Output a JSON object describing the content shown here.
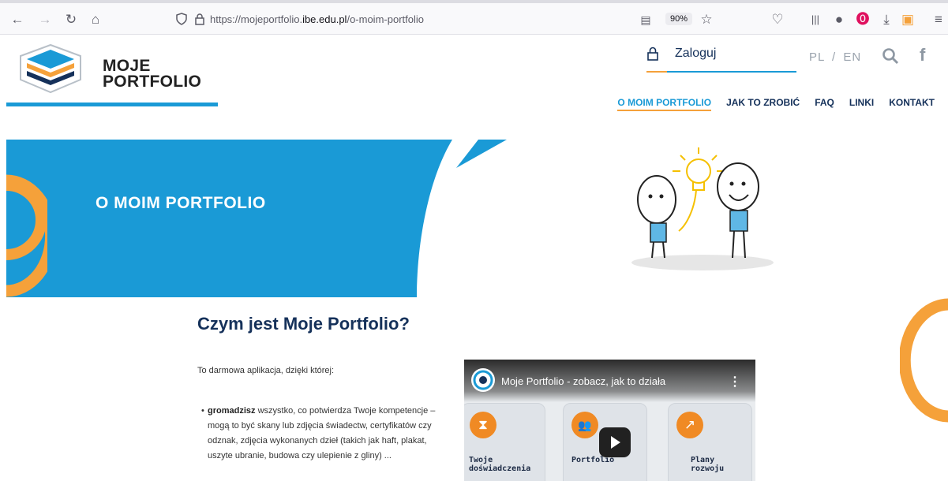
{
  "browser": {
    "back_icon": "back-arrow-icon",
    "forward_icon": "forward-arrow-icon",
    "url_prefix": "https://mojeportfolio.",
    "url_domain": "ibe.edu.pl",
    "url_path": "/o-moim-portfolio",
    "zoom": "90%"
  },
  "site": {
    "logo_line1": "MOJE",
    "logo_line2": "PORTFOLIO",
    "login_label": "Zaloguj",
    "lang_pl": "PL",
    "lang_sep": "/",
    "lang_en": "EN",
    "facebook": "f",
    "nav": [
      "O MOIM PORTFOLIO",
      "JAK TO ZROBIĆ",
      "FAQ",
      "LINKI",
      "KONTAKT"
    ]
  },
  "hero": {
    "title": "O MOIM PORTFOLIO"
  },
  "content": {
    "heading": "Czym jest Moje Portfolio?",
    "intro": "To darmowa aplikacja, dzięki której:",
    "bullet1_bold": "gromadzisz",
    "bullet1_rest": " wszystko, co potwierdza Twoje kompetencje – mogą to być skany lub zdjęcia świadectw, certyfikatów czy odznak, zdjęcia wykonanych dzieł (takich jak haft, plakat, uszyte ubranie, budowa czy ulepienie z gliny) ..."
  },
  "video": {
    "title": "Moje Portfolio - zobacz, jak to działa",
    "menu": "⋮",
    "cards": [
      {
        "label": "Twoje\ndoświadczenia",
        "icon": "hourglass-icon",
        "glyph": "⧗"
      },
      {
        "label": "Portfolio",
        "icon": "people-icon",
        "glyph": "👥"
      },
      {
        "label": "Plany\nrozwoju",
        "icon": "trend-up-icon",
        "glyph": "↗"
      }
    ]
  },
  "colors": {
    "accent_blue": "#1a9ad6",
    "accent_orange": "#f5a13a",
    "navy": "#15315a"
  }
}
